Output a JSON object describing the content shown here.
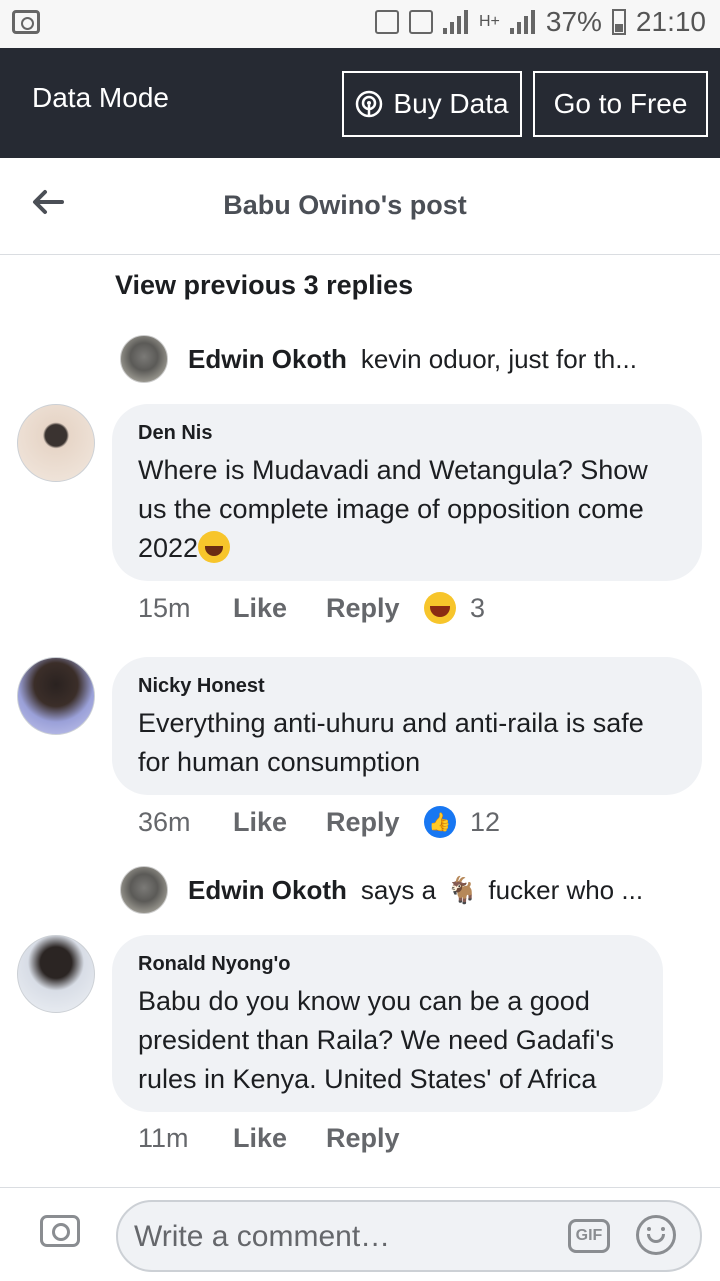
{
  "status_bar": {
    "battery": "37%",
    "time": "21:10",
    "network": "H+"
  },
  "data_mode": {
    "title": "Data Mode",
    "buy_label": "Buy Data",
    "free_label": "Go to Free"
  },
  "header": {
    "title": "Babu Owino's post"
  },
  "view_previous": "View previous 3 replies",
  "replies": [
    {
      "name": "Edwin Okoth",
      "text": "kevin oduor, just for th..."
    },
    {
      "name": "Edwin Okoth",
      "text_before": "says a",
      "emoji": "🐐",
      "text_after": "fucker who ..."
    }
  ],
  "comments": [
    {
      "name": "Den Nis",
      "text": "Where is Mudavadi and Wetangula? Show us the complete image of opposition come 2022",
      "time": "15m",
      "like": "Like",
      "reply": "Reply",
      "reaction": "haha",
      "count": "3"
    },
    {
      "name": "Nicky Honest",
      "text": "Everything anti-uhuru and anti-raila is safe for human consumption",
      "time": "36m",
      "like": "Like",
      "reply": "Reply",
      "reaction": "like",
      "count": "12"
    },
    {
      "name": "Ronald Nyong'o",
      "text": "Babu do you know you can be a good president than Raila? We need Gadafi's rules in Kenya. United States' of Africa",
      "time": "11m",
      "like": "Like",
      "reply": "Reply"
    }
  ],
  "composer": {
    "placeholder": "Write a comment…",
    "gif_label": "GIF"
  },
  "colors": {
    "top_bar": "#262a33",
    "bubble": "#f0f2f5",
    "like_blue": "#1877f2",
    "muted": "#65676b"
  }
}
